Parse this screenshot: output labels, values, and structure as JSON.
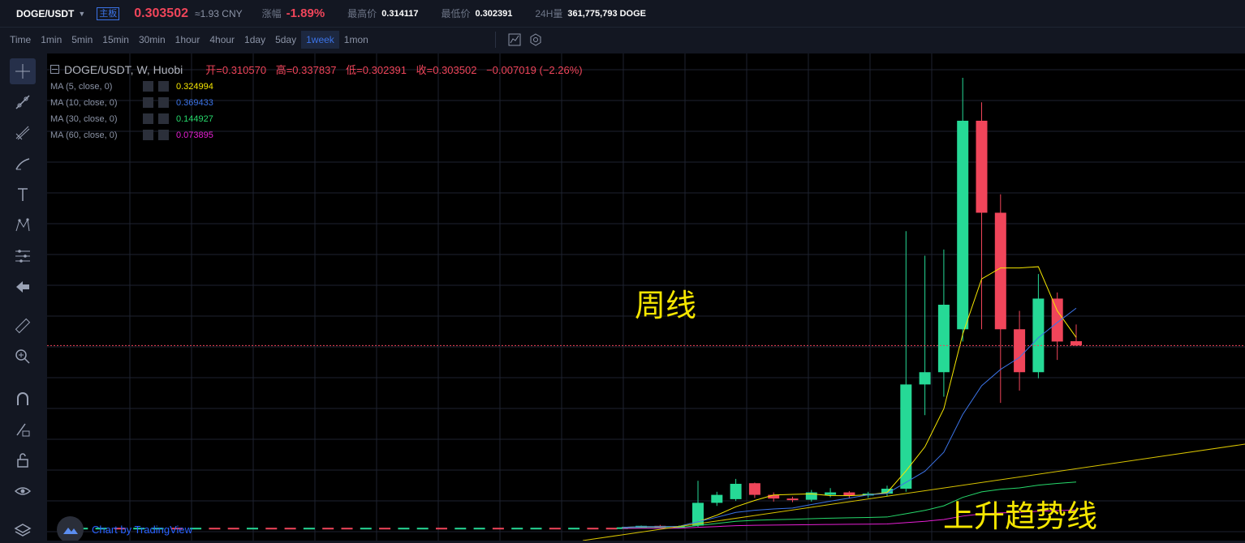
{
  "ticker": {
    "pair": "DOGE/USDT",
    "mode_badge": "主板",
    "price": "0.303502",
    "cny": "≈1.93 CNY",
    "change_label": "涨幅",
    "change_value": "-1.89%",
    "high_label": "最高价",
    "high_value": "0.314117",
    "low_label": "最低价",
    "low_value": "0.302391",
    "volume_label": "24H量",
    "volume_value": "361,775,793 DOGE"
  },
  "timeframes": [
    "Time",
    "1min",
    "5min",
    "15min",
    "30min",
    "1hour",
    "4hour",
    "1day",
    "5day",
    "1week",
    "1mon"
  ],
  "active_timeframe": "1week",
  "toolbar_icons": [
    "chart-type-icon",
    "settings-icon"
  ],
  "sidebar_tools": [
    "crosshair-icon",
    "trend-line-icon",
    "fib-icon",
    "brush-icon",
    "text-icon",
    "pattern-icon",
    "measure-projection-icon",
    "back-arrow-icon",
    "ruler-icon",
    "zoom-icon",
    "magnet-icon",
    "lock-draw-icon",
    "unlock-icon",
    "eye-icon",
    "layers-icon"
  ],
  "legend": {
    "title": "DOGE/USDT, W, Huobi",
    "open": "开=0.310570",
    "high": "高=0.337837",
    "low": "低=0.302391",
    "close": "收=0.303502",
    "change": "−0.007019 (−2.26%)"
  },
  "ma": [
    {
      "label": "MA (5, close, 0)",
      "value": "0.324994",
      "color": "#f5e600"
    },
    {
      "label": "MA (10, close, 0)",
      "value": "0.369433",
      "color": "#3b73e6"
    },
    {
      "label": "MA (30, close, 0)",
      "value": "0.144927",
      "color": "#26d96b"
    },
    {
      "label": "MA (60, close, 0)",
      "value": "0.073895",
      "color": "#e61fd4"
    }
  ],
  "annotations": {
    "weekly": "周线",
    "uptrend": "上升趋势线"
  },
  "watermark": "Chart by TradingView",
  "colors": {
    "up": "#26d996",
    "down": "#f0455a",
    "background": "#000000",
    "annotation": "#f5e600",
    "accent": "#3b73e6"
  },
  "chart_data": {
    "type": "candlestick",
    "symbol": "DOGE/USDT",
    "interval": "W",
    "last_close": 0.303502,
    "candles": [
      {
        "o": 0.006,
        "h": 0.008,
        "l": 0.0055,
        "c": 0.007
      },
      {
        "o": 0.007,
        "h": 0.01,
        "l": 0.006,
        "c": 0.0095
      },
      {
        "o": 0.0095,
        "h": 0.011,
        "l": 0.008,
        "c": 0.0085
      },
      {
        "o": 0.0085,
        "h": 0.01,
        "l": 0.008,
        "c": 0.0092
      },
      {
        "o": 0.01,
        "h": 0.083,
        "l": 0.008,
        "c": 0.047
      },
      {
        "o": 0.047,
        "h": 0.065,
        "l": 0.042,
        "c": 0.06
      },
      {
        "o": 0.053,
        "h": 0.086,
        "l": 0.05,
        "c": 0.078
      },
      {
        "o": 0.079,
        "h": 0.08,
        "l": 0.055,
        "c": 0.06
      },
      {
        "o": 0.06,
        "h": 0.064,
        "l": 0.049,
        "c": 0.054
      },
      {
        "o": 0.054,
        "h": 0.057,
        "l": 0.048,
        "c": 0.052
      },
      {
        "o": 0.052,
        "h": 0.068,
        "l": 0.049,
        "c": 0.064
      },
      {
        "o": 0.06,
        "h": 0.071,
        "l": 0.056,
        "c": 0.064
      },
      {
        "o": 0.064,
        "h": 0.066,
        "l": 0.054,
        "c": 0.059
      },
      {
        "o": 0.059,
        "h": 0.065,
        "l": 0.055,
        "c": 0.062
      },
      {
        "o": 0.062,
        "h": 0.075,
        "l": 0.058,
        "c": 0.07
      },
      {
        "o": 0.07,
        "h": 0.49,
        "l": 0.065,
        "c": 0.24
      },
      {
        "o": 0.24,
        "h": 0.45,
        "l": 0.19,
        "c": 0.26
      },
      {
        "o": 0.26,
        "h": 0.46,
        "l": 0.22,
        "c": 0.37
      },
      {
        "o": 0.33,
        "h": 0.74,
        "l": 0.31,
        "c": 0.67
      },
      {
        "o": 0.67,
        "h": 0.7,
        "l": 0.33,
        "c": 0.52
      },
      {
        "o": 0.52,
        "h": 0.55,
        "l": 0.21,
        "c": 0.33
      },
      {
        "o": 0.33,
        "h": 0.36,
        "l": 0.23,
        "c": 0.26
      },
      {
        "o": 0.26,
        "h": 0.42,
        "l": 0.25,
        "c": 0.38
      },
      {
        "o": 0.38,
        "h": 0.39,
        "l": 0.28,
        "c": 0.31
      },
      {
        "o": 0.3106,
        "h": 0.3378,
        "l": 0.3024,
        "c": 0.3035
      }
    ]
  }
}
